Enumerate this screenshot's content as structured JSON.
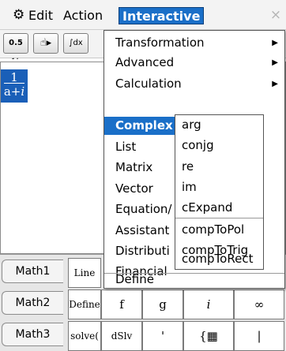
{
  "menubar": {
    "edit": "Edit",
    "action": "Action",
    "interactive": "Interactive",
    "close": "×"
  },
  "toolbar": {
    "frac_label": "0.5 ½",
    "hand_label": "☝▸",
    "dx_label": "∫dx"
  },
  "work": {
    "entry_numerator": "1",
    "entry_denominator": "a+𝑖"
  },
  "interactive_menu": {
    "items": [
      {
        "label": "Transformation",
        "has_submenu": true
      },
      {
        "label": "Advanced",
        "has_submenu": true
      },
      {
        "label": "Calculation",
        "has_submenu": true
      },
      {
        "label": "Complex",
        "has_submenu": false,
        "selected": true
      },
      {
        "label": "List",
        "has_submenu": false
      },
      {
        "label": "Matrix",
        "has_submenu": false
      },
      {
        "label": "Vector",
        "has_submenu": false
      },
      {
        "label": "Equation/",
        "has_submenu": false
      },
      {
        "label": "Assistant",
        "has_submenu": false
      },
      {
        "label": "Distributi",
        "has_submenu": false
      },
      {
        "label": "Financial",
        "has_submenu": false
      },
      {
        "label": "Define",
        "has_submenu": false
      }
    ]
  },
  "complex_submenu": {
    "items": [
      "arg",
      "conjg",
      "re",
      "im",
      "cExpand",
      "compToPol",
      "compToTrig",
      "compToRect"
    ]
  },
  "keyboard": {
    "tabs": [
      "Math1",
      "Math2",
      "Math3"
    ],
    "row1": [
      "Line"
    ],
    "row2": [
      "Define",
      "f",
      "g",
      "𝑖",
      "∞"
    ],
    "row3": [
      "solve(",
      "dSlv",
      "'",
      "{▦",
      "|"
    ]
  },
  "colors": {
    "accent": "#1a6fc8",
    "entry_bg": "#1a5fb8"
  }
}
